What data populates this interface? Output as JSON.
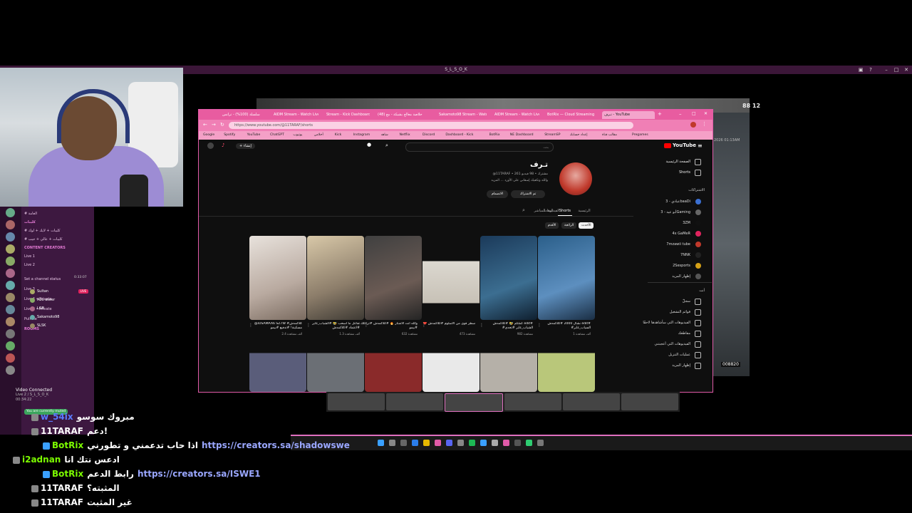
{
  "remote_desktop": {
    "title": "S_L_S_O_K"
  },
  "discord": {
    "rows": [
      {
        "text": "# العامة",
        "type": "channel"
      },
      {
        "text": "كليبات",
        "type": "header"
      },
      {
        "text": "# كليبات + لايك + لوك",
        "type": "channel"
      },
      {
        "text": "# كليبات + عالي + جيب",
        "type": "channel"
      },
      {
        "text": "CONTENT CREATORS",
        "type": "header"
      },
      {
        "text": "Live 1",
        "type": "channel"
      },
      {
        "text": "Live 2",
        "type": "channel"
      },
      {
        "text": "Set a channel status",
        "type": "status"
      },
      {
        "text": "Live 3",
        "type": "channel"
      },
      {
        "text": "Live 4 • Private",
        "type": "channel"
      },
      {
        "text": "Live 5 • Private",
        "type": "channel"
      },
      {
        "text": "Pull Me",
        "type": "channel"
      },
      {
        "text": "ROOMS",
        "type": "header"
      }
    ],
    "live_badge": "LIVE",
    "voice_timer": "0:33:07",
    "members": [
      "Sultan",
      "Abo aseer",
      "LGB",
      "Sakamoto98",
      "SLSK"
    ],
    "voice_status": "Video Connected",
    "voice_channel": "Live 2 / S_L_S_O_K",
    "voice_time": "00:34:22",
    "toast": "You are currently muted"
  },
  "chat": [
    {
      "name": "w_54ix",
      "text": "مبروك سوسو",
      "link": "",
      "name_color": "#5a7bff"
    },
    {
      "name": "11TARAF",
      "text": "دعم!",
      "link": "",
      "name_color": "#ffffff"
    },
    {
      "name": "BotRix",
      "text": "اذا حاب تدعمني و تطورني",
      "link": "https://creators.sa/shadowswe",
      "name_color": "#7cfc00"
    },
    {
      "name": "i2adnan",
      "text": "ادعس نتك انا",
      "link": "",
      "name_color": "#7cfc00"
    },
    {
      "name": "BotRix",
      "text": "رابط الدعم",
      "link": "https://creators.sa/ISWE1",
      "name_color": "#7cfc00"
    },
    {
      "name": "11TARAF",
      "text": "المثبته؟",
      "link": "",
      "name_color": "#ffffff"
    },
    {
      "name": "11TARAF",
      "text": "غير المثبت",
      "link": "",
      "name_color": "#ffffff"
    }
  ],
  "game": {
    "clock": "88 12",
    "time": "2026 01:13AM",
    "counter": "008820"
  },
  "browser": {
    "tabs": [
      {
        "label": "سلسلة (100%) - ترانس",
        "active": false
      },
      {
        "label": "AIDM Stream - Watch Live",
        "active": false
      },
      {
        "label": "Stream - Kick Dashboard",
        "active": false
      },
      {
        "label": "(48) خلاصة معالج بشبكة - مع",
        "active": false
      },
      {
        "label": "Sakamoto98 Stream - Watch",
        "active": false
      },
      {
        "label": "AIDM Stream - Watch Live",
        "active": false
      },
      {
        "label": "BotRix — Cloud Streaming",
        "active": false
      },
      {
        "label": "تـرف - YouTube",
        "active": true
      }
    ],
    "url": "https://www.youtube.com/@11TARAF/shorts",
    "bookmarks": [
      "Google",
      "Spotify",
      "YouTube",
      "ChatGPT",
      "يوتيوب",
      "أحلامي",
      "Kick",
      "Instagram",
      "شاهد",
      "Netflix",
      "Discord",
      "Dashboard - Kick",
      "BotRix",
      "NE Dashboard",
      "StreamSP",
      "إعداد حسابك",
      "مقالب قناة",
      "Pregames"
    ]
  },
  "youtube": {
    "logo": "YouTube",
    "search_placeholder": "بحث",
    "create_label": "إنشاء",
    "nav": [
      "الصفحة الرئيسية",
      "Shorts"
    ],
    "subs_header": "الاشتراكات",
    "subs": [
      "عبادي - 3baaDi",
      "أبو عيد - 3Gaming",
      "3ZM",
      "4x GaMeR",
      "7mzawii tube",
      "7NNK",
      "2Sesports",
      "إظهار المزيد"
    ],
    "you_header": "أنت",
    "you_items": [
      "سجلّ",
      "قوائم التشغيل",
      "الفيديوهات التي سأشاهدها لاحقًا",
      "مقاطعك",
      "الفيديوهات التي أعجبتني",
      "عمليات التنزيل",
      "إظهار المزيد"
    ],
    "channel": {
      "name": "تـرف",
      "meta": "@11TARAF • 261 مشترك • 98 فيديو",
      "desc": "والله وتكفيك إسقاني على الأورد ... المزيد",
      "subscribed": "تم الاشتراك",
      "join": "الانضمام"
    },
    "tabs": [
      "الرئيسية",
      "الفيديوهات",
      "Shorts",
      "البث المباشر"
    ],
    "active_tab": "Shorts",
    "chips": [
      "الأحدث",
      "الرائجة",
      "الأقدم"
    ],
    "shorts": [
      {
        "title": "@iOSAMAA6 SZ7W #كلاكمدش مسكينة! #تدفيع #بيمو",
        "views": "2.4 ألف مشاهدة"
      },
      {
        "title": "تفاعل ما اسحب 🤣 #الشباب_غاير #اعتماد #كلاكمدش",
        "views": "1.3 ألف مشاهدة"
      },
      {
        "title": "والله أنت الأشتار 🔥 #كلاكمدش #تراكلك #بيمو",
        "views": "632 مشاهدة"
      },
      {
        "title": "❤️ سطر قوي من الأسلوم #كلاكمدش",
        "views": "473 مشاهدة"
      },
      {
        "title": "كملكم 🤣 #كلاكمدش edit# #الشباب_غاير #تحدي",
        "views": "982 مشاهدة"
      },
      {
        "title": "نشال 2000 #كلاكمدش edit# #السياب_غاير",
        "views": "1 ألف مشاهدة"
      }
    ]
  }
}
